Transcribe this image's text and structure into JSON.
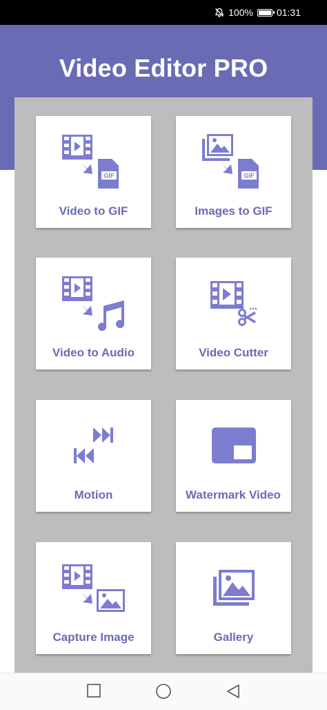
{
  "status": {
    "battery": "100%",
    "time": "01:31"
  },
  "app": {
    "title": "Video Editor PRO"
  },
  "tiles": [
    {
      "label": "Video to GIF"
    },
    {
      "label": "Images to GIF"
    },
    {
      "label": "Video to Audio"
    },
    {
      "label": "Video Cutter"
    },
    {
      "label": "Motion"
    },
    {
      "label": "Watermark Video"
    },
    {
      "label": "Capture Image"
    },
    {
      "label": "Gallery"
    }
  ],
  "icons": {
    "gif_badge": "GIF"
  },
  "colors": {
    "accent": "#6a6bb5",
    "icon": "#7c7dcf",
    "panel": "#bdbdbd"
  }
}
